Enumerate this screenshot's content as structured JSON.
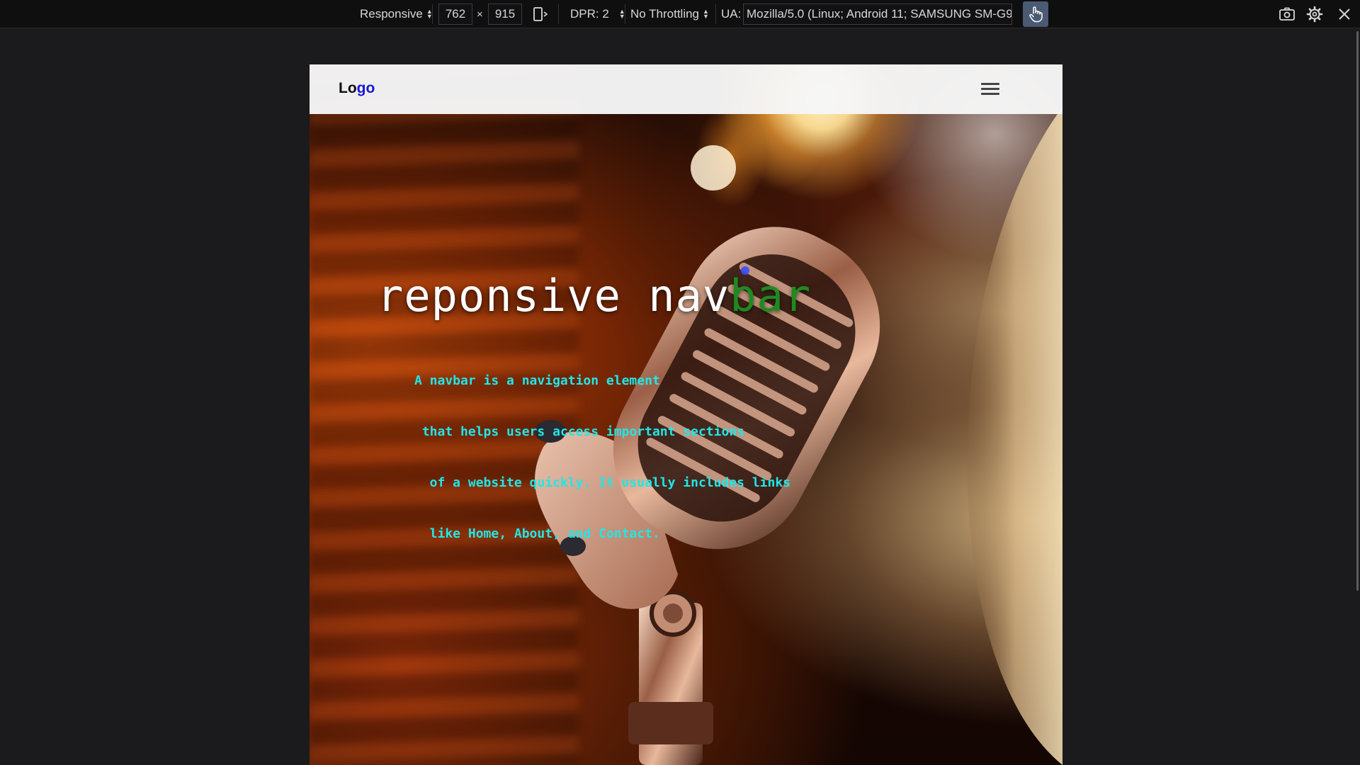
{
  "devtools": {
    "device_mode": "Responsive",
    "width": "762",
    "times": "×",
    "height": "915",
    "dpr": "DPR: 2",
    "throttling": "No Throttling",
    "ua_label": "UA:",
    "ua_value": "Mozilla/5.0 (Linux; Android 11; SAMSUNG SM-G97",
    "icons": [
      "rotate-device-icon",
      "touch-hand-icon",
      "screenshot-camera-icon",
      "settings-gear-icon",
      "close-icon"
    ]
  },
  "page": {
    "navbar": {
      "logo_part1": "Lo",
      "logo_part2": "go",
      "menu_icon": "hamburger-menu-icon"
    },
    "hero": {
      "title_white": "reponsive nav",
      "title_green": "bar",
      "description_lines": [
        "A navbar is a navigation element",
        " that helps users access important sections",
        "  of a website quickly. It usually includes links",
        "  like Home, About, and Contact."
      ]
    }
  },
  "colors": {
    "logo_accent": "#1616d6",
    "title_accent": "#1f8a1f",
    "description": "#22e6e6",
    "touch_button": "#4a5a73"
  }
}
